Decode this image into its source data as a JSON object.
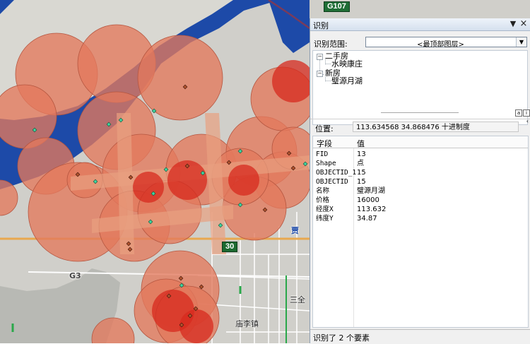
{
  "map": {
    "road_labels": [
      "G107",
      "G3",
      "30"
    ],
    "place_labels": [
      "庙李镇",
      "三全",
      "贾"
    ],
    "colors": {
      "background": "#d0cfca",
      "river": "#1d4aa8",
      "buffer_fill": "#e3795c",
      "buffer_core": "#c8281c",
      "points_green": "#3fd6a0",
      "points_brown": "#b0532e"
    }
  },
  "panel": {
    "title": "识别",
    "buttons": {
      "collapse": "▼",
      "close": "×",
      "pin": "‹"
    },
    "identify_from_label": "识别范围:",
    "identify_from_value": "<最顶部图层>",
    "tree": [
      {
        "label": "二手房",
        "toggle": "−",
        "children": [
          "水映康庄"
        ]
      },
      {
        "label": "新房",
        "toggle": "−",
        "children": [
          "璧源月湖"
        ]
      }
    ],
    "location_label": "位置:",
    "location_value": "113.634568  34.868476 十进制度",
    "grid_headers": {
      "field": "字段",
      "value": "值"
    },
    "rows": [
      {
        "field": "FID",
        "value": "13"
      },
      {
        "field": "Shape",
        "value": "点"
      },
      {
        "field": "OBJECTID_1",
        "value": "15"
      },
      {
        "field": "OBJECTID",
        "value": "15"
      },
      {
        "field": "名称",
        "value": "璧源月湖"
      },
      {
        "field": "价格",
        "value": "16000"
      },
      {
        "field": "经度X",
        "value": "113.632"
      },
      {
        "field": "纬度Y",
        "value": "34.87"
      }
    ],
    "status": "识别了 2 个要素"
  }
}
